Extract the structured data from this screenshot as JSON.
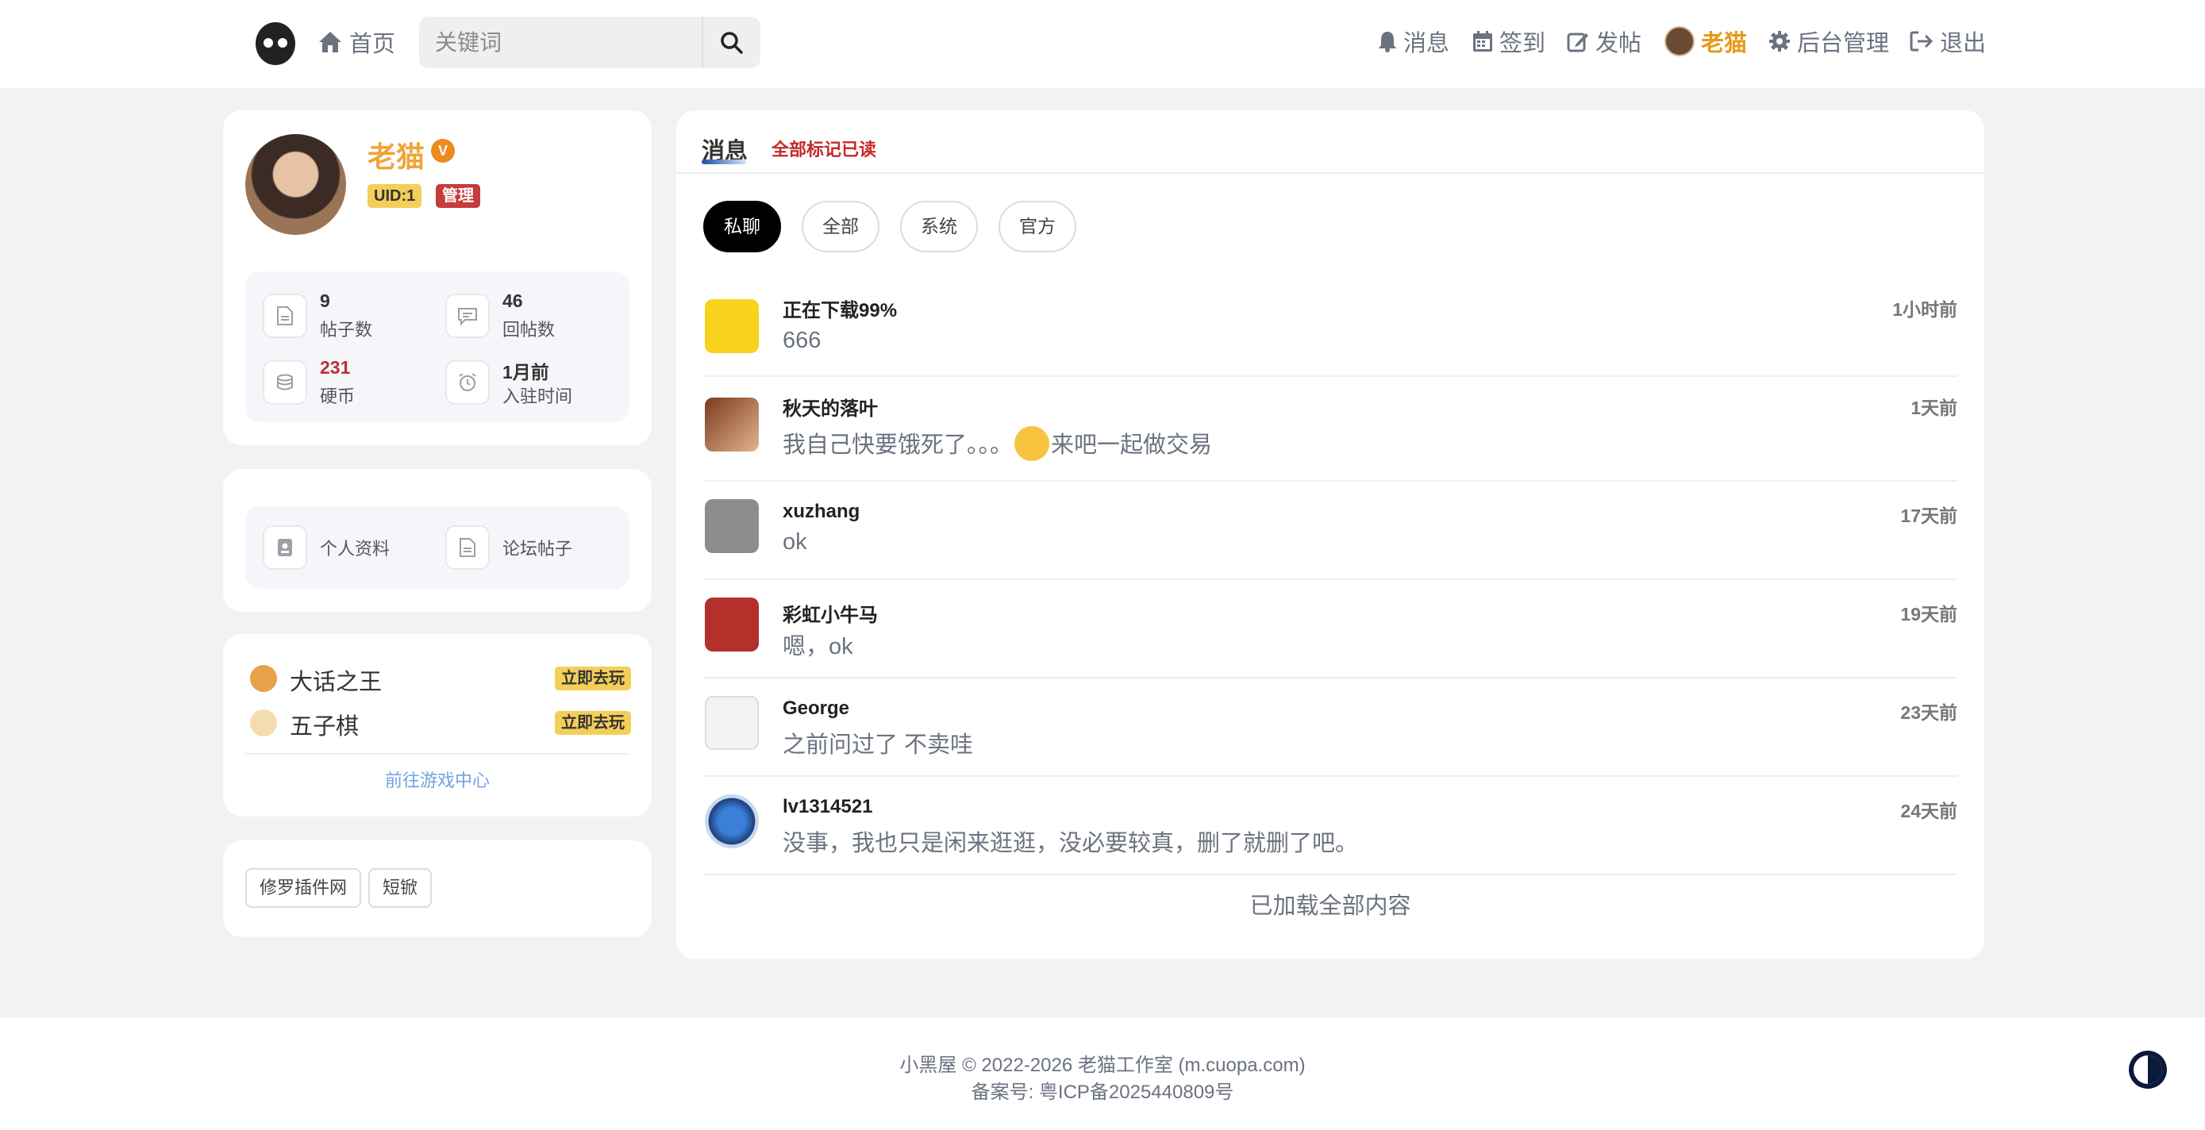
{
  "header": {
    "home_label": "首页",
    "search_placeholder": "关键词",
    "nav": {
      "messages": "消息",
      "checkin": "签到",
      "post": "发帖",
      "user": "老猫",
      "admin": "后台管理",
      "logout": "退出"
    }
  },
  "profile": {
    "name": "老猫",
    "verified_badge": "V",
    "uid": "UID:1",
    "role": "管理",
    "stats": [
      {
        "value": "9",
        "label": "帖子数"
      },
      {
        "value": "46",
        "label": "回帖数"
      },
      {
        "value": "231",
        "label": "硬币"
      },
      {
        "value": "1月前",
        "label": "入驻时间"
      }
    ]
  },
  "links": {
    "profile": "个人资料",
    "posts": "论坛帖子"
  },
  "games": {
    "items": [
      {
        "name": "大话之王",
        "action": "立即去玩"
      },
      {
        "name": "五子棋",
        "action": "立即去玩"
      }
    ],
    "center_link": "前往游戏中心"
  },
  "tags": [
    "修罗插件网",
    "短锨"
  ],
  "messages": {
    "title": "消息",
    "mark_all_read": "全部标记已读",
    "tabs": [
      "私聊",
      "全部",
      "系统",
      "官方"
    ],
    "active_tab": "私聊",
    "items": [
      {
        "name": "正在下载99%",
        "text": "666",
        "time": "1小时前"
      },
      {
        "name": "秋天的落叶",
        "text_before": "我自己快要饿死了。。。",
        "text_after": "来吧一起做交易",
        "time": "1天前"
      },
      {
        "name": "xuzhang",
        "text": "ok",
        "time": "17天前"
      },
      {
        "name": "彩虹小牛马",
        "text": "嗯，ok",
        "time": "19天前"
      },
      {
        "name": "George",
        "text": "之前问过了 不卖哇",
        "time": "23天前"
      },
      {
        "name": "lv1314521",
        "text": "没事，我也只是闲来逛逛，没必要较真，删了就删了吧。",
        "time": "24天前"
      }
    ],
    "loaded_text": "已加载全部内容"
  },
  "footer": {
    "copyright": "小黑屋 © 2022-2026 老猫工作室 (m.cuopa.com)",
    "icp": "备案号: 粤ICP备2025440809号"
  },
  "colors": {
    "accent_orange": "#f0a43a",
    "admin_red": "#c63b3b",
    "uid_yellow": "#f3cf5a",
    "link_blue": "#6fa3e0"
  }
}
